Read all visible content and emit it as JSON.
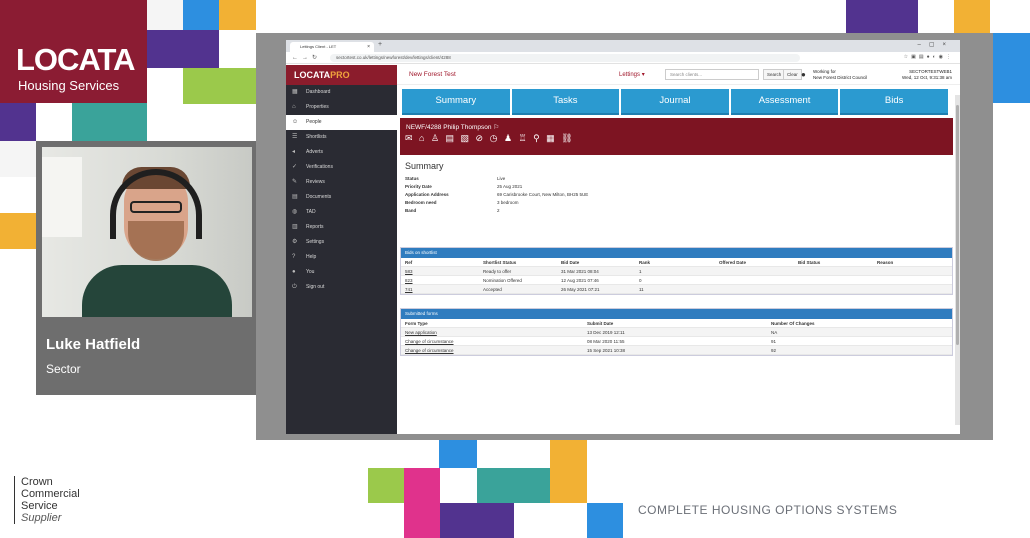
{
  "overlay": {
    "logo_brand": "LOCATA",
    "logo_sub": "Housing Services",
    "presenter_name": "Luke Hatfield",
    "presenter_role": "Sector",
    "ccs_line1": "Crown",
    "ccs_line2": "Commercial",
    "ccs_line3": "Service",
    "ccs_line4": "Supplier",
    "tagline": "COMPLETE HOUSING OPTIONS SYSTEMS"
  },
  "browser": {
    "tab_title": "Lettings Client - LET",
    "url": "sectortest.co.uk/lettings/newforest/dev/lettings/client/4288"
  },
  "app": {
    "brand_a": "LOCATA",
    "brand_b": "PRO",
    "org_title": "New Forest Test",
    "module_menu": "Lettings",
    "search_placeholder": "Search clients...",
    "search_button": "Search",
    "clear_button": "Clear",
    "working_for_label": "Working for",
    "working_for_value": "New Forest District Council",
    "user_code": "SECTORTESTWEB1",
    "datetime": "Wed, 12 Oct, 9:31:38 am"
  },
  "sidebar": {
    "items": [
      {
        "label": "Dashboard",
        "icon": "dashboard-icon",
        "glyph": "▦"
      },
      {
        "label": "Properties",
        "icon": "house-icon",
        "glyph": "⌂"
      },
      {
        "label": "People",
        "icon": "people-icon",
        "glyph": "☺"
      },
      {
        "label": "Shortlists",
        "icon": "list-icon",
        "glyph": "☰"
      },
      {
        "label": "Adverts",
        "icon": "megaphone-icon",
        "glyph": "◂"
      },
      {
        "label": "Verifications",
        "icon": "check-icon",
        "glyph": "✓"
      },
      {
        "label": "Reviews",
        "icon": "pencil-icon",
        "glyph": "✎"
      },
      {
        "label": "Documents",
        "icon": "document-icon",
        "glyph": "▤"
      },
      {
        "label": "TAD",
        "icon": "globe-icon",
        "glyph": "◍"
      },
      {
        "label": "Reports",
        "icon": "report-icon",
        "glyph": "▥"
      },
      {
        "label": "Settings",
        "icon": "gear-icon",
        "glyph": "⚙"
      },
      {
        "label": "Help",
        "icon": "help-icon",
        "glyph": "?"
      },
      {
        "label": "You",
        "icon": "user-icon",
        "glyph": "●"
      },
      {
        "label": "Sign out",
        "icon": "power-icon",
        "glyph": "⏻"
      }
    ],
    "active_index": 2
  },
  "tabs": [
    "Summary",
    "Tasks",
    "Journal",
    "Assessment",
    "Bids"
  ],
  "client": {
    "header": "NEWF/4288 Philip Thompson",
    "icons": "✉ ⌂ ♙ ▤ ▧ ⊘ ◷ ♟ ♖ ⚲ ▦ ⛓"
  },
  "summary": {
    "title": "Summary",
    "rows": [
      {
        "k": "Status",
        "v": "Live"
      },
      {
        "k": "Priority Date",
        "v": "25 Aug 2021"
      },
      {
        "k": "Application Address",
        "v": "69 Carisbrooke Court, New Milton, BH25 5UE"
      },
      {
        "k": "Bedroom need",
        "v": "3 bedroom"
      },
      {
        "k": "Band",
        "v": "2"
      }
    ]
  },
  "bids_panel": {
    "title": "Bids on shortlist",
    "headers": [
      "Ref",
      "Shortlist Status",
      "Bid Date",
      "Rank",
      "Offered Date",
      "Bid Status",
      "Reason"
    ],
    "rows": [
      [
        "583",
        "Ready to offer",
        "31 Mar 2021 08:04",
        "1",
        "",
        "",
        ""
      ],
      [
        "823",
        "Nomination Offered",
        "12 Aug 2021 07:46",
        "0",
        "",
        "",
        ""
      ],
      [
        "741",
        "Accepted",
        "26 May 2021 07:21",
        "11",
        "",
        "",
        ""
      ]
    ]
  },
  "forms_panel": {
    "title": "Submitted forms",
    "headers": [
      "Form Type",
      "Submit Date",
      "Number Of Changes"
    ],
    "rows": [
      [
        "New application",
        "13 Dec 2019 12:11",
        "NA"
      ],
      [
        "Change of circumstance",
        "08 Mar 2020 11:55",
        "91"
      ],
      [
        "Change of circumstance",
        "15 Sep 2021 10:38",
        "92"
      ]
    ]
  },
  "colors": {
    "brand": "#8b1c33",
    "tab_blue": "#2b9ad0",
    "banner": "#7d1422",
    "panel_header": "#2f7cbf"
  }
}
